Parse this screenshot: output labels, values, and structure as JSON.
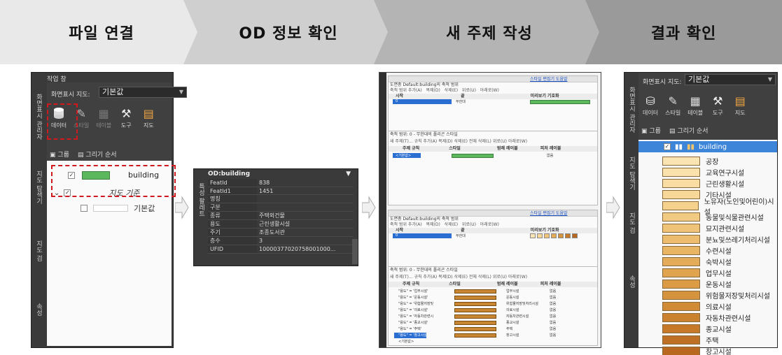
{
  "steps": [
    "파일 연결",
    "OD 정보 확인",
    "새 주제 작성",
    "결과 확인"
  ],
  "panel1": {
    "title": "작업 창",
    "vtabs": [
      "화면표시 관리자",
      "지도 탐색기",
      "지도 검",
      "속성"
    ],
    "map_label": "화면표시 지도:",
    "map_value": "기본값",
    "tools": [
      "데이터",
      "스타일",
      "테이블",
      "도구",
      "지도"
    ],
    "subtabs": [
      "그룹",
      "그리기 순서"
    ],
    "layer": "building",
    "group": "지도 기준",
    "default": "기본값"
  },
  "panel2": {
    "header": "OD:building",
    "vtab": "특성 팔레트",
    "rows": [
      [
        "FeatId",
        "838"
      ],
      [
        "FeatId1",
        "1451"
      ],
      [
        "명칭",
        ""
      ],
      [
        "구분",
        ""
      ],
      [
        "종류",
        "주택외건물"
      ],
      [
        "용도",
        "근린생활시설"
      ],
      [
        "주기",
        "조종도서관"
      ],
      [
        "층수",
        "3"
      ],
      [
        "UFID",
        "10000377020758001000..."
      ]
    ]
  },
  "panel3": {
    "top_title": "도면층 Default:building의 축척 범위",
    "link": "스타일 편집기 도움말",
    "toolbar": [
      "축척 범위 추가(A)",
      "복제(D)",
      "삭제(E)",
      "위로(U)",
      "아래로(W)"
    ],
    "cols": [
      "시작",
      "끝",
      "미리보기 기호화"
    ],
    "start": "0",
    "end": "무한대",
    "lower_title": "축척 범위: 0 - 무한대의 폴리곤 스타일",
    "lower_toolbar": [
      "새 주제(T)...",
      "규칙 추가(A)",
      "복제(D)",
      "삭제(E)",
      "전체 삭제(L)",
      "위로(U)",
      "아래로(W)"
    ],
    "lower_cols": [
      "주제 규칙",
      "스타일",
      "범례 레이블",
      "피처 레이블"
    ],
    "first_rule": "<기본값>",
    "first_label": "없음",
    "rules": [
      [
        "\"용도\" = '업무시설'",
        "업무시설",
        "없음"
      ],
      [
        "\"용도\" = '운동시설'",
        "운동시설",
        "없음"
      ],
      [
        "\"용도\" = '위험물저장및",
        "위험물저장및처리시설",
        "없음"
      ],
      [
        "\"용도\" = '의료시설'",
        "의료시설",
        "없음"
      ],
      [
        "\"용도\" = '자동차관련시",
        "자동차관련시설",
        "없음"
      ],
      [
        "\"용도\" = '종교시설'",
        "종교시설",
        "없음"
      ],
      [
        "\"용도\" = '주택'",
        "주택",
        "없음"
      ],
      [
        "\"용도\" = '창고시설'",
        "창고시설",
        "없음"
      ],
      [
        "<기본값>",
        "",
        ""
      ]
    ]
  },
  "panel4": {
    "map_label": "화면표시 지도:",
    "map_value": "기본값",
    "vtabs": [
      "화면표시 관리자",
      "지도 탐색기",
      "지도 검",
      "속성"
    ],
    "tools": [
      "데이터",
      "스타일",
      "테이블",
      "도구",
      "지도"
    ],
    "subtabs": [
      "그룹",
      "그리기 순서"
    ],
    "layer": "building",
    "items": [
      {
        "label": "공장",
        "color": "#fbe4b4"
      },
      {
        "label": "교육연구시설",
        "color": "#fbe1ac"
      },
      {
        "label": "근린생활시설",
        "color": "#f9dda2"
      },
      {
        "label": "기타시설",
        "color": "#f7d898"
      },
      {
        "label": "노유자(노인및어린이)시설",
        "color": "#f5d28d"
      },
      {
        "label": "동물및식물관련시설",
        "color": "#f2cb82"
      },
      {
        "label": "묘지관련시설",
        "color": "#efc478"
      },
      {
        "label": "분뇨및쓰레기처리시설",
        "color": "#ecbd6e"
      },
      {
        "label": "수련시설",
        "color": "#e8b563"
      },
      {
        "label": "숙박시설",
        "color": "#e4ac58"
      },
      {
        "label": "업무시설",
        "color": "#e0a44f"
      },
      {
        "label": "운동시설",
        "color": "#dc9c46"
      },
      {
        "label": "위험물저장및처리시설",
        "color": "#d6933e"
      },
      {
        "label": "의료시설",
        "color": "#d18a36"
      },
      {
        "label": "자동차관련시설",
        "color": "#cb822f"
      },
      {
        "label": "종교시설",
        "color": "#c57929"
      },
      {
        "label": "주택",
        "color": "#be7124"
      },
      {
        "label": "창고시설",
        "color": "#b8691f"
      }
    ]
  },
  "colors": {
    "dashed_highlight": "#d0181f",
    "selection": "#3d85d8",
    "layer_green": "#5cb85c"
  }
}
